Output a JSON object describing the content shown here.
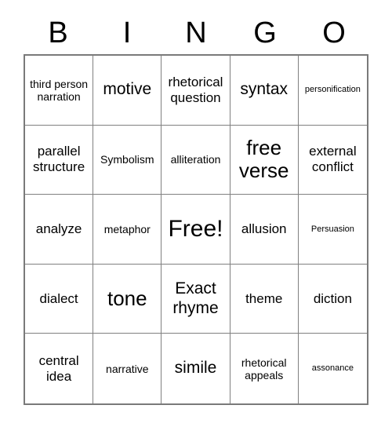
{
  "header": {
    "letters": [
      "B",
      "I",
      "N",
      "G",
      "O"
    ]
  },
  "grid": {
    "columns": 5,
    "rows": 5,
    "cells": [
      {
        "text": "third person narration",
        "size": "sm"
      },
      {
        "text": "motive",
        "size": "lg"
      },
      {
        "text": "rhetorical question",
        "size": "md"
      },
      {
        "text": "syntax",
        "size": "lg"
      },
      {
        "text": "personification",
        "size": "xs"
      },
      {
        "text": "parallel structure",
        "size": "md"
      },
      {
        "text": "Symbolism",
        "size": "sm"
      },
      {
        "text": "alliteration",
        "size": "sm"
      },
      {
        "text": "free verse",
        "size": "xl"
      },
      {
        "text": "external conflict",
        "size": "md"
      },
      {
        "text": "analyze",
        "size": "md"
      },
      {
        "text": "metaphor",
        "size": "sm"
      },
      {
        "text": "Free!",
        "size": "xxl"
      },
      {
        "text": "allusion",
        "size": "md"
      },
      {
        "text": "Persuasion",
        "size": "xs"
      },
      {
        "text": "dialect",
        "size": "md"
      },
      {
        "text": "tone",
        "size": "xl"
      },
      {
        "text": "Exact rhyme",
        "size": "lg"
      },
      {
        "text": "theme",
        "size": "md"
      },
      {
        "text": "diction",
        "size": "md"
      },
      {
        "text": "central idea",
        "size": "md"
      },
      {
        "text": "narrative",
        "size": "sm"
      },
      {
        "text": "simile",
        "size": "lg"
      },
      {
        "text": "rhetorical appeals",
        "size": "sm"
      },
      {
        "text": "assonance",
        "size": "xs"
      }
    ]
  },
  "style": {
    "background_color": "#ffffff",
    "text_color": "#000000",
    "outer_border_color": "#7a7a7a",
    "inner_border_color": "#808080"
  }
}
